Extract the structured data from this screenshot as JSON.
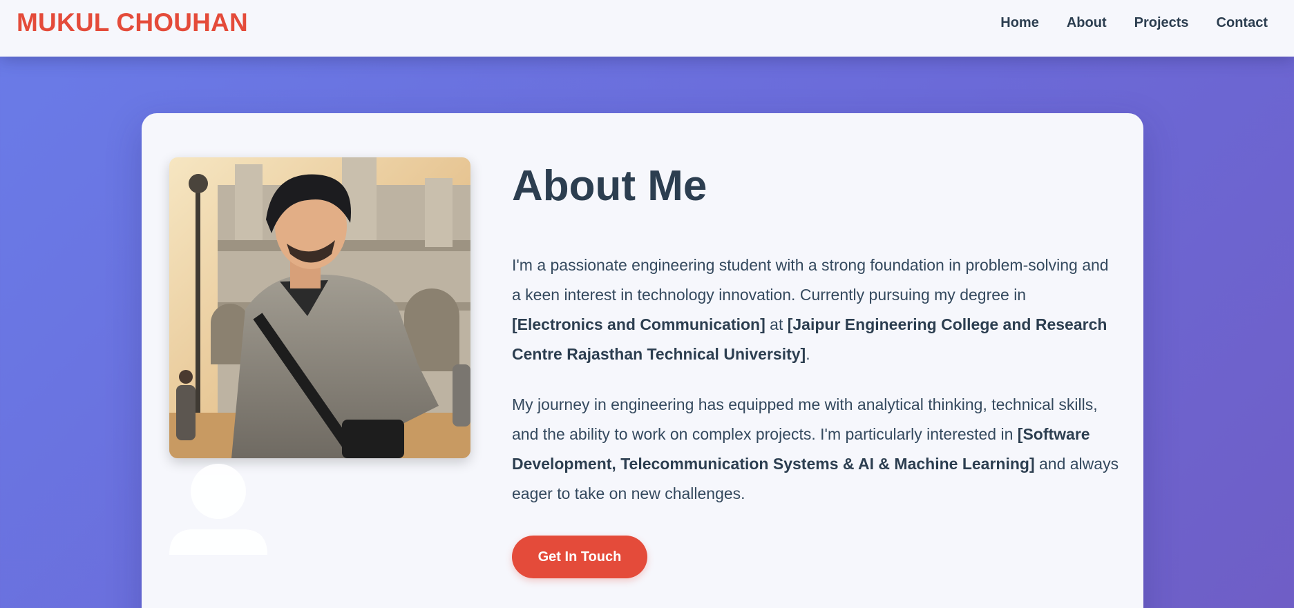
{
  "header": {
    "brand": "MUKUL CHOUHAN",
    "nav": [
      "Home",
      "About",
      "Projects",
      "Contact"
    ]
  },
  "about": {
    "title": "About Me",
    "p1": {
      "intro": "I'm a passionate engineering student with a strong foundation in problem-solving and a keen interest in technology innovation. Currently pursuing my degree in ",
      "degree": "[Electronics and Communication]",
      "at": " at ",
      "college": "[Jaipur Engineering College and Research Centre Rajasthan Technical University]",
      "end": "."
    },
    "p2": {
      "intro": "My journey in engineering has equipped me with analytical thinking, technical skills, and the ability to work on complex projects. I'm particularly interested in ",
      "interests": "[Software Development, Telecommunication Systems & AI & Machine Learning]",
      "end": " and always eager to take on new challenges."
    },
    "cta_label": "Get In Touch"
  },
  "colors": {
    "accent": "#e44b3a",
    "text_dark": "#2c3e50",
    "background_gradient_start": "#6a7ce8",
    "background_gradient_end": "#6f5ec6"
  },
  "icons": {
    "placeholder": "user-silhouette-icon"
  }
}
